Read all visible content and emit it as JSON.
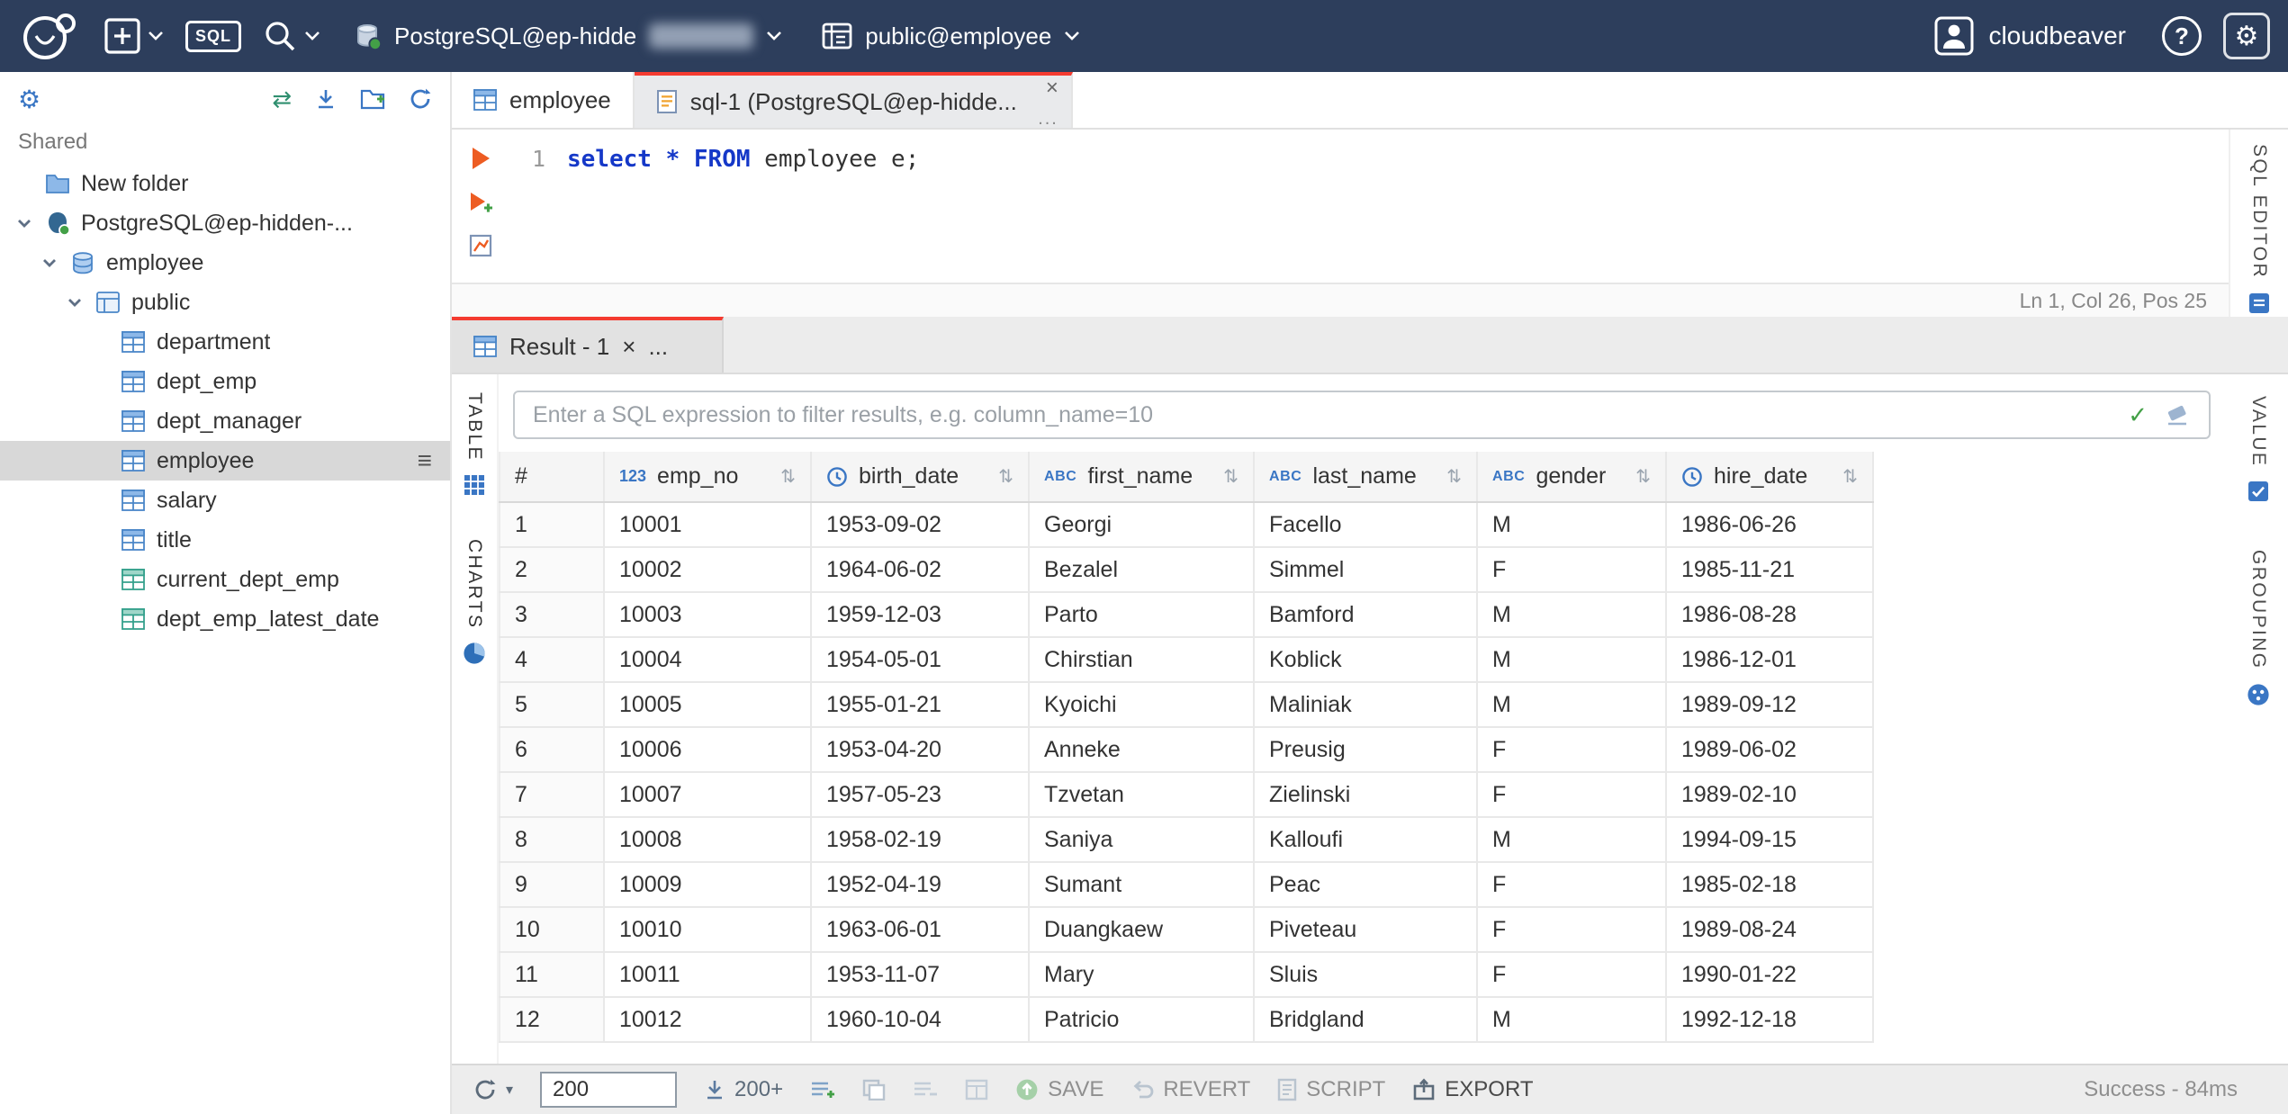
{
  "header": {
    "sql_badge": "SQL",
    "connection_label": "PostgreSQL@ep-hidde",
    "schema_label": "public@employee",
    "user_label": "cloudbeaver",
    "help_glyph": "?"
  },
  "sidebar": {
    "shared_label": "Shared",
    "tree": [
      {
        "label": "New folder",
        "icon": "folder",
        "level": 0
      },
      {
        "label": "PostgreSQL@ep-hidden-...",
        "icon": "postgres",
        "level": 0,
        "expandable": true
      },
      {
        "label": "employee",
        "icon": "database",
        "level": 1,
        "expandable": true
      },
      {
        "label": "public",
        "icon": "schema",
        "level": 2,
        "expandable": true
      },
      {
        "label": "department",
        "icon": "table",
        "level": 3
      },
      {
        "label": "dept_emp",
        "icon": "table",
        "level": 3
      },
      {
        "label": "dept_manager",
        "icon": "table",
        "level": 3
      },
      {
        "label": "employee",
        "icon": "table",
        "level": 3,
        "selected": true
      },
      {
        "label": "salary",
        "icon": "table",
        "level": 3
      },
      {
        "label": "title",
        "icon": "table",
        "level": 3
      },
      {
        "label": "current_dept_emp",
        "icon": "view",
        "level": 3
      },
      {
        "label": "dept_emp_latest_date",
        "icon": "view",
        "level": 3
      }
    ]
  },
  "tabs": {
    "table_tab": "employee",
    "sql_tab": "sql-1 (PostgreSQL@ep-hidde...",
    "more_glyph": "..."
  },
  "editor": {
    "line_number": "1",
    "tokens": [
      {
        "text": "select",
        "type": "keyword"
      },
      {
        "text": " ",
        "type": "plain"
      },
      {
        "text": "*",
        "type": "keyword"
      },
      {
        "text": " ",
        "type": "plain"
      },
      {
        "text": "FROM",
        "type": "keyword"
      },
      {
        "text": " employee e;",
        "type": "plain"
      }
    ],
    "status": "Ln 1, Col 26, Pos 25",
    "rail_label": "SQL EDITOR"
  },
  "result": {
    "tab_label": "Result - 1",
    "filter_placeholder": "Enter a SQL expression to filter results, e.g. column_name=10",
    "left_tabs": [
      "TABLE",
      "CHARTS"
    ],
    "right_tabs": [
      "VALUE",
      "GROUPING"
    ]
  },
  "grid": {
    "columns": [
      {
        "name": "#",
        "type": ""
      },
      {
        "name": "emp_no",
        "type": "123"
      },
      {
        "name": "birth_date",
        "type": "date"
      },
      {
        "name": "first_name",
        "type": "abc"
      },
      {
        "name": "last_name",
        "type": "abc"
      },
      {
        "name": "gender",
        "type": "abc"
      },
      {
        "name": "hire_date",
        "type": "date"
      }
    ],
    "rows": [
      [
        "1",
        "10001",
        "1953-09-02",
        "Georgi",
        "Facello",
        "M",
        "1986-06-26"
      ],
      [
        "2",
        "10002",
        "1964-06-02",
        "Bezalel",
        "Simmel",
        "F",
        "1985-11-21"
      ],
      [
        "3",
        "10003",
        "1959-12-03",
        "Parto",
        "Bamford",
        "M",
        "1986-08-28"
      ],
      [
        "4",
        "10004",
        "1954-05-01",
        "Chirstian",
        "Koblick",
        "M",
        "1986-12-01"
      ],
      [
        "5",
        "10005",
        "1955-01-21",
        "Kyoichi",
        "Maliniak",
        "M",
        "1989-09-12"
      ],
      [
        "6",
        "10006",
        "1953-04-20",
        "Anneke",
        "Preusig",
        "F",
        "1989-06-02"
      ],
      [
        "7",
        "10007",
        "1957-05-23",
        "Tzvetan",
        "Zielinski",
        "F",
        "1989-02-10"
      ],
      [
        "8",
        "10008",
        "1958-02-19",
        "Saniya",
        "Kalloufi",
        "M",
        "1994-09-15"
      ],
      [
        "9",
        "10009",
        "1952-04-19",
        "Sumant",
        "Peac",
        "F",
        "1985-02-18"
      ],
      [
        "10",
        "10010",
        "1963-06-01",
        "Duangkaew",
        "Piveteau",
        "F",
        "1989-08-24"
      ],
      [
        "11",
        "10011",
        "1953-11-07",
        "Mary",
        "Sluis",
        "F",
        "1990-01-22"
      ],
      [
        "12",
        "10012",
        "1960-10-04",
        "Patricio",
        "Bridgland",
        "M",
        "1992-12-18"
      ]
    ]
  },
  "toolbar": {
    "fetch_size": "200",
    "fetch_page": "200+",
    "save_label": "SAVE",
    "revert_label": "REVERT",
    "script_label": "SCRIPT",
    "export_label": "EXPORT",
    "status": "Success - 84ms"
  },
  "colors": {
    "header_bg": "#2d3e5c",
    "accent_red": "#f43b30",
    "keyword_blue": "#1538c8",
    "icon_blue": "#3a76c4",
    "success_green": "#43a047"
  }
}
